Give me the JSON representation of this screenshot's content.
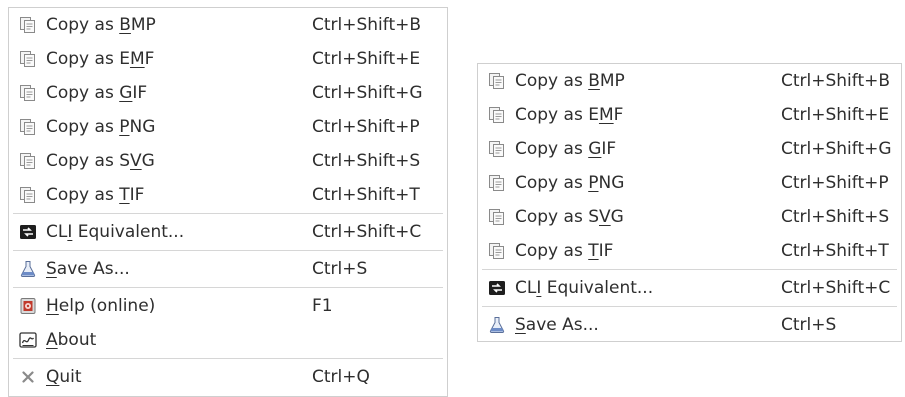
{
  "left_menu": {
    "copy_items": [
      {
        "pre": "Copy as ",
        "key": "B",
        "post": "MP",
        "shortcut": "Ctrl+Shift+B",
        "icon": "copy-icon"
      },
      {
        "pre": "Copy as E",
        "key": "M",
        "post": "F",
        "shortcut": "Ctrl+Shift+E",
        "icon": "copy-icon"
      },
      {
        "pre": "Copy as ",
        "key": "G",
        "post": "IF",
        "shortcut": "Ctrl+Shift+G",
        "icon": "copy-icon"
      },
      {
        "pre": "Copy as ",
        "key": "P",
        "post": "NG",
        "shortcut": "Ctrl+Shift+P",
        "icon": "copy-icon"
      },
      {
        "pre": "Copy as S",
        "key": "V",
        "post": "G",
        "shortcut": "Ctrl+Shift+S",
        "icon": "copy-icon"
      },
      {
        "pre": "Copy as ",
        "key": "T",
        "post": "IF",
        "shortcut": "Ctrl+Shift+T",
        "icon": "copy-icon"
      }
    ],
    "cli": {
      "pre": "CL",
      "key": "I",
      "post": " Equivalent...",
      "shortcut": "Ctrl+Shift+C",
      "icon": "terminal-icon"
    },
    "save": {
      "pre": "",
      "key": "S",
      "post": "ave As...",
      "shortcut": "Ctrl+S",
      "icon": "save-flask-icon"
    },
    "help": {
      "pre": "",
      "key": "H",
      "post": "elp (online)",
      "shortcut": "F1",
      "icon": "help-book-icon"
    },
    "about": {
      "pre": "",
      "key": "A",
      "post": "bout",
      "shortcut": "",
      "icon": "about-icon"
    },
    "quit": {
      "pre": "",
      "key": "Q",
      "post": "uit",
      "shortcut": "Ctrl+Q",
      "icon": "close-x-icon"
    }
  },
  "right_menu": {
    "copy_items": [
      {
        "pre": "Copy as ",
        "key": "B",
        "post": "MP",
        "shortcut": "Ctrl+Shift+B",
        "icon": "copy-icon"
      },
      {
        "pre": "Copy as E",
        "key": "M",
        "post": "F",
        "shortcut": "Ctrl+Shift+E",
        "icon": "copy-icon"
      },
      {
        "pre": "Copy as ",
        "key": "G",
        "post": "IF",
        "shortcut": "Ctrl+Shift+G",
        "icon": "copy-icon"
      },
      {
        "pre": "Copy as ",
        "key": "P",
        "post": "NG",
        "shortcut": "Ctrl+Shift+P",
        "icon": "copy-icon"
      },
      {
        "pre": "Copy as S",
        "key": "V",
        "post": "G",
        "shortcut": "Ctrl+Shift+S",
        "icon": "copy-icon"
      },
      {
        "pre": "Copy as ",
        "key": "T",
        "post": "IF",
        "shortcut": "Ctrl+Shift+T",
        "icon": "copy-icon"
      }
    ],
    "cli": {
      "pre": "CL",
      "key": "I",
      "post": " Equivalent...",
      "shortcut": "Ctrl+Shift+C",
      "icon": "terminal-icon"
    },
    "save": {
      "pre": "",
      "key": "S",
      "post": "ave As...",
      "shortcut": "Ctrl+S",
      "icon": "save-flask-icon"
    }
  },
  "colors": {
    "text": "#2e2e2e",
    "border": "#cfcfcf",
    "separator": "#d6d6d6",
    "help_icon": "#c0392b"
  }
}
